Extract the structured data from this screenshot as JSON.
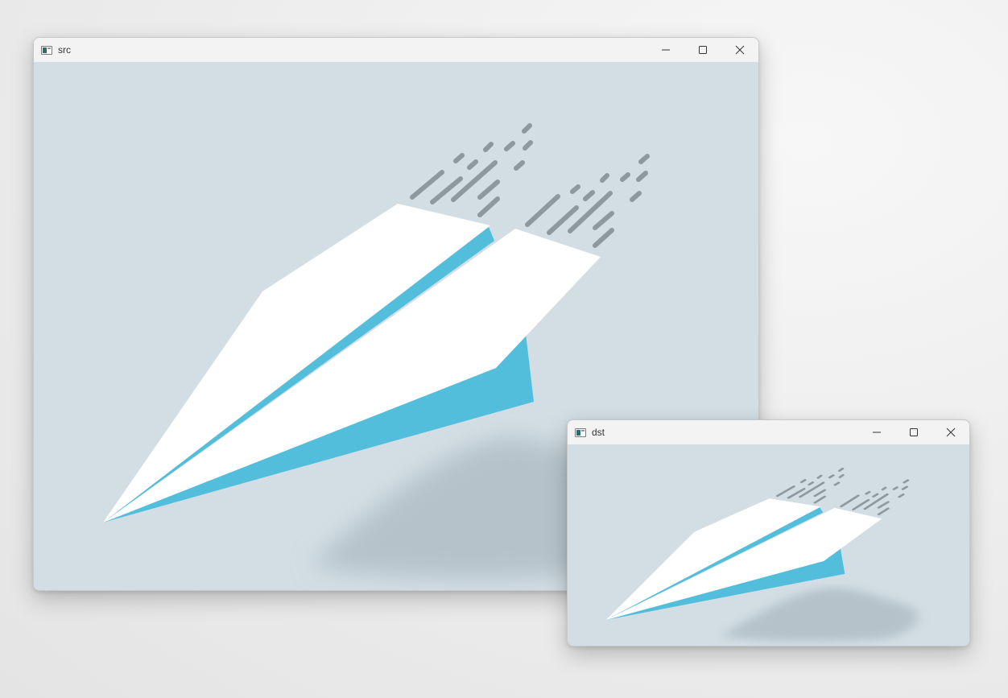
{
  "windows": {
    "src": {
      "title": "src",
      "controls": [
        "minimize-icon",
        "maximize-icon",
        "close-icon"
      ]
    },
    "dst": {
      "title": "dst",
      "controls": [
        "minimize-icon",
        "maximize-icon",
        "close-icon"
      ]
    }
  },
  "colors": {
    "desktop": "#ececec",
    "canvas_bg": "#d2dde4",
    "plane_white": "#ffffff",
    "plane_fold": "#52bedb",
    "speed_lines": "#8d989f",
    "shadow": "#b5c2ca"
  },
  "image_content": "paper-airplane-illustration"
}
